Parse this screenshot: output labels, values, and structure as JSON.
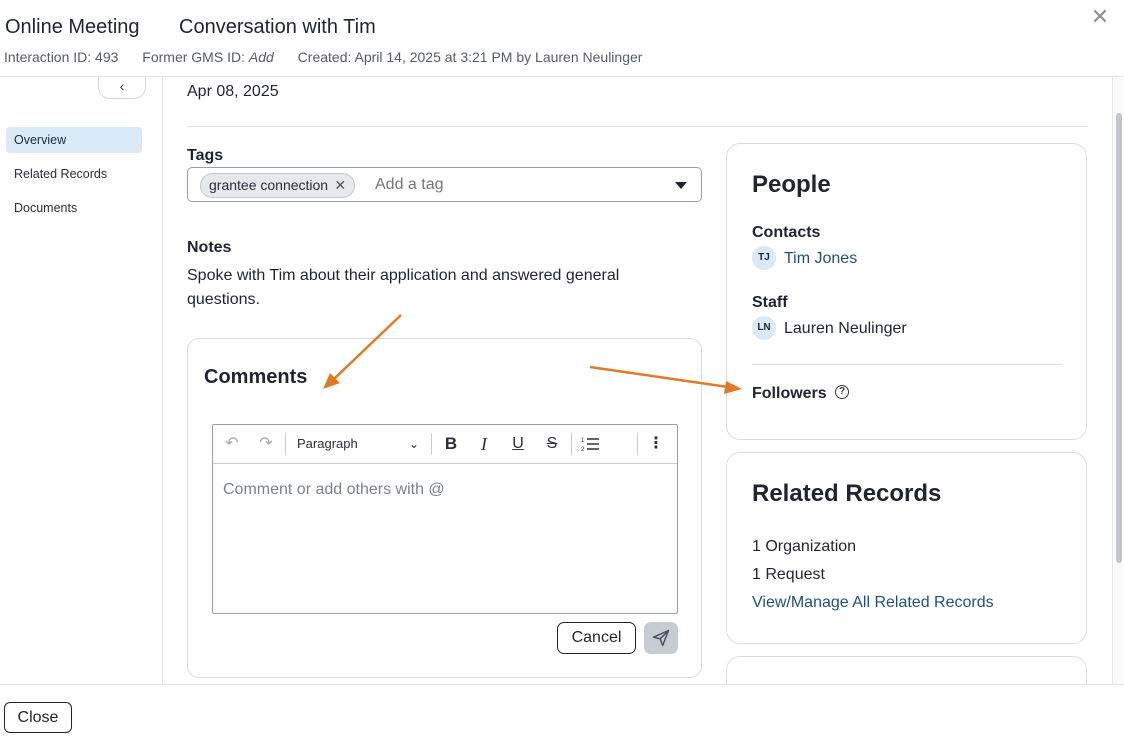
{
  "header": {
    "record_type": "Online Meeting",
    "title": "Conversation with Tim",
    "interaction_id": "Interaction ID: 493",
    "former_gms_label": "Former GMS ID: ",
    "former_gms_value": "Add",
    "created": "Created: April 14, 2025 at 3:21 PM by Lauren Neulinger"
  },
  "nav": {
    "items": [
      {
        "label": "Overview",
        "active": true
      },
      {
        "label": "Related Records",
        "active": false
      },
      {
        "label": "Documents",
        "active": false
      }
    ]
  },
  "main": {
    "date": "Apr 08, 2025",
    "tags_label": "Tags",
    "tags": [
      "grantee connection"
    ],
    "tag_placeholder": "Add a tag",
    "notes_label": "Notes",
    "notes_text": "Spoke with Tim about their application and answered general questions."
  },
  "comments": {
    "title": "Comments",
    "block_format": "Paragraph",
    "placeholder": "Comment or add others with @",
    "cancel_label": "Cancel"
  },
  "people": {
    "title": "People",
    "contacts_label": "Contacts",
    "contacts": [
      {
        "initials": "TJ",
        "name": "Tim Jones"
      }
    ],
    "staff_label": "Staff",
    "staff": [
      {
        "initials": "LN",
        "name": "Lauren Neulinger"
      }
    ],
    "followers_label": "Followers"
  },
  "related_records": {
    "title": "Related Records",
    "lines": [
      "1 Organization",
      "1 Request"
    ],
    "manage_link": "View/Manage All Related Records"
  },
  "footer": {
    "close_label": "Close"
  },
  "icons": {
    "close": "close-icon",
    "collapse": "chevron-left-icon",
    "help": "help-circle-icon",
    "send": "send-icon"
  },
  "colors": {
    "accent_link": "#1e4f82",
    "nav_active_bg": "#dbeaf7",
    "annotation_arrow": "#e07b24"
  }
}
